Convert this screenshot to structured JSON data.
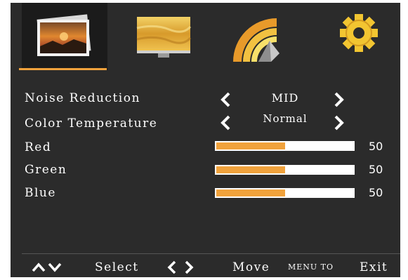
{
  "tabs": [
    {
      "icon": "picture-icon",
      "active": true
    },
    {
      "icon": "monitor-icon",
      "active": false
    },
    {
      "icon": "sound-icon",
      "active": false
    },
    {
      "icon": "settings-gear-icon",
      "active": false
    }
  ],
  "menu": {
    "noise_reduction": {
      "label": "Noise Reduction",
      "value": "MID"
    },
    "color_temperature": {
      "label": "Color Temperature",
      "value": "Normal"
    },
    "red": {
      "label": "Red",
      "value": 50,
      "level": 0.5
    },
    "green": {
      "label": "Green",
      "value": 50,
      "level": 0.5
    },
    "blue": {
      "label": "Blue",
      "value": 50,
      "level": 0.5
    }
  },
  "footer": {
    "select_label": "Select",
    "move_label": "Move",
    "menu_to_label": "MENU TO",
    "exit_label": "Exit"
  },
  "colors": {
    "accent": "#f0a23c",
    "background": "#2b2b2b",
    "active_tab": "#1b1b1b"
  }
}
